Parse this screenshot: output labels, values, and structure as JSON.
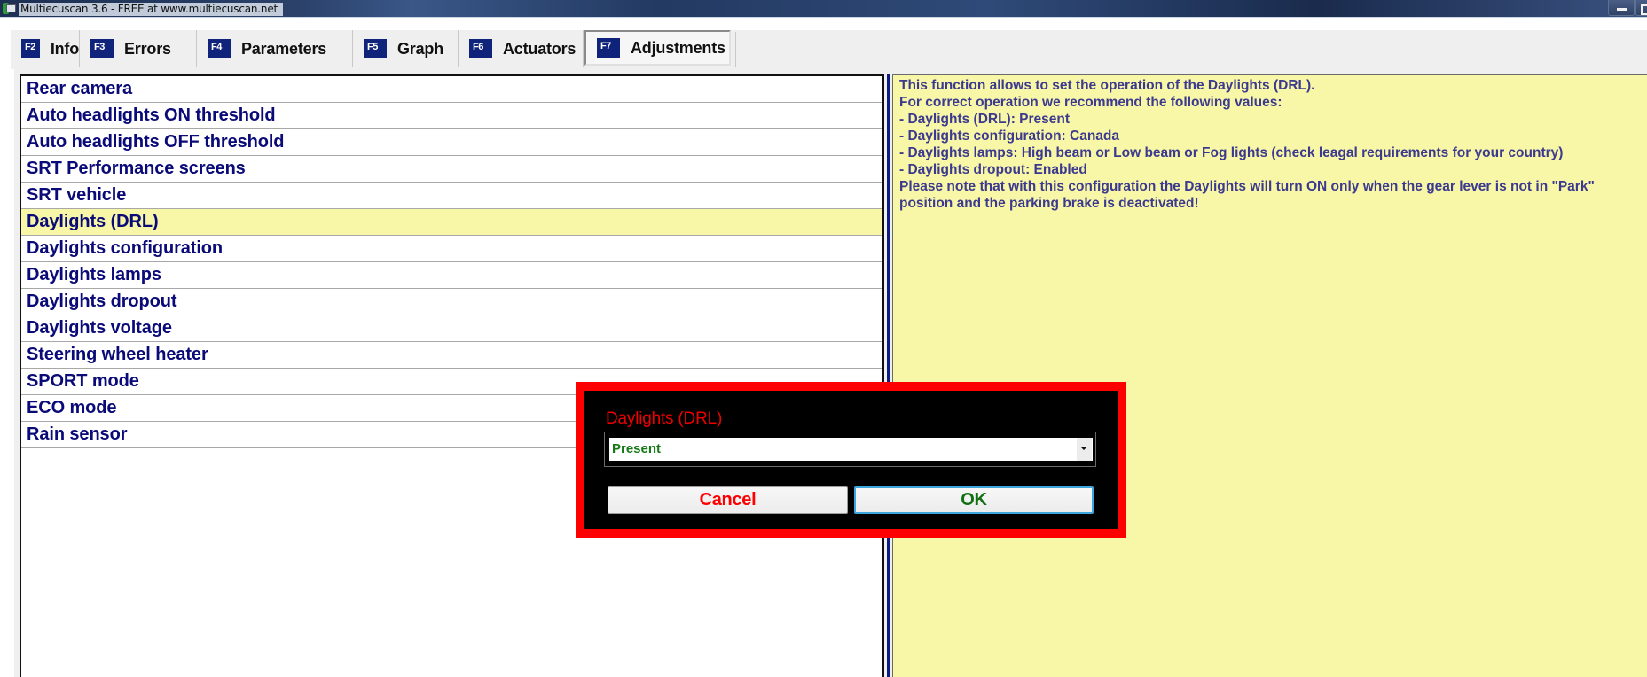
{
  "window": {
    "title": "Multiecuscan 3.6 - FREE at www.multiecuscan.net",
    "controls": [
      "minimize",
      "restore"
    ]
  },
  "tabs": [
    {
      "key": "F2",
      "label": "Info",
      "active": false
    },
    {
      "key": "F3",
      "label": "Errors",
      "active": false
    },
    {
      "key": "F4",
      "label": "Parameters",
      "active": false
    },
    {
      "key": "F5",
      "label": "Graph",
      "active": false
    },
    {
      "key": "F6",
      "label": "Actuators",
      "active": false
    },
    {
      "key": "F7",
      "label": "Adjustments",
      "active": true
    }
  ],
  "adjustments": {
    "items": [
      "Rear camera",
      "Auto headlights ON threshold",
      "Auto headlights OFF threshold",
      "SRT Performance screens",
      "SRT vehicle",
      "Daylights (DRL)",
      "Daylights configuration",
      "Daylights lamps",
      "Daylights dropout",
      "Daylights voltage",
      "Steering wheel heater",
      "SPORT mode",
      "ECO mode",
      "Rain sensor"
    ],
    "selected": "Daylights (DRL)"
  },
  "description": {
    "lines": [
      "This function allows to set the operation of the Daylights (DRL).",
      "For correct operation we recommend the following values:",
      "- Daylights (DRL): Present",
      "- Daylights configuration: Canada",
      "- Daylights lamps: High beam or Low beam or Fog lights (check leagal requirements for your country)",
      "- Daylights dropout: Enabled",
      "Please note that with this configuration the Daylights will turn ON only when the gear lever is not in \"Park\"",
      "position and the parking brake is deactivated!"
    ]
  },
  "dialog": {
    "title": "Daylights (DRL)",
    "selected_value": "Present",
    "cancel_label": "Cancel",
    "ok_label": "OK",
    "colors": {
      "border": "#ff0000",
      "title": "#ee0000",
      "value": "#157a15",
      "cancel": "#ff0000",
      "ok": "#127012"
    }
  },
  "colors": {
    "list_text": "#0a0a78",
    "selected_row": "#f8f6a7",
    "description_bg": "#f8f6a7",
    "description_text": "#3c3a8e",
    "fkey_badge": "#0f237a"
  }
}
